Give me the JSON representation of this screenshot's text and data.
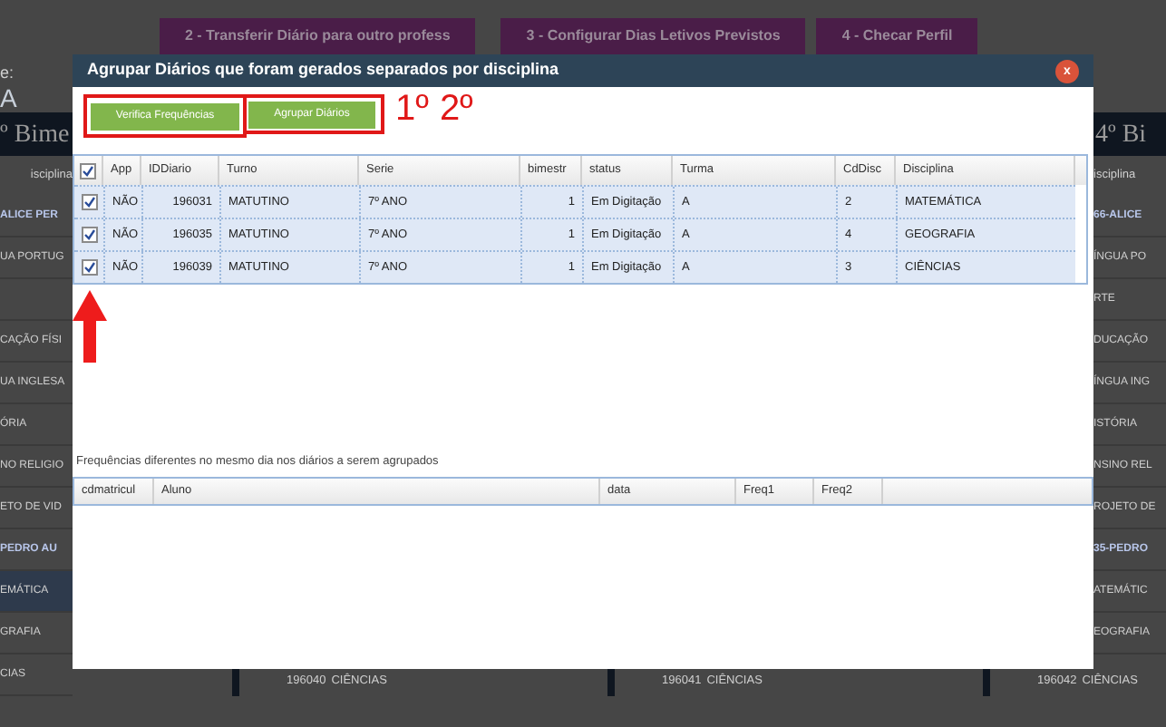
{
  "background": {
    "top_buttons": [
      "2 - Transferir Diário para outro profess",
      "3 - Configurar Dias Letivos Previstos",
      "4 - Checar Perfil"
    ],
    "left_column": {
      "letter": "A",
      "label": "e:",
      "heading": "º Bime",
      "column_header": "isciplina",
      "rows": [
        {
          "text": "ALICE PER",
          "kind": "group",
          "selected": false
        },
        {
          "text": "UA PORTUG",
          "kind": "item",
          "selected": false
        },
        {
          "text": "",
          "kind": "item",
          "selected": false
        },
        {
          "text": "CAÇÃO FÍSI",
          "kind": "item",
          "selected": false
        },
        {
          "text": "UA INGLESA",
          "kind": "item",
          "selected": false
        },
        {
          "text": "ÓRIA",
          "kind": "item",
          "selected": false
        },
        {
          "text": "NO RELIGIO",
          "kind": "item",
          "selected": false
        },
        {
          "text": "ETO DE VID",
          "kind": "item",
          "selected": false
        },
        {
          "text": "PEDRO AU",
          "kind": "group",
          "selected": false
        },
        {
          "text": "EMÁTICA",
          "kind": "item",
          "selected": true
        },
        {
          "text": "GRAFIA",
          "kind": "item",
          "selected": false
        },
        {
          "text": "CIAS",
          "kind": "item",
          "selected": false
        }
      ]
    },
    "right_column": {
      "heading": "4º Bi",
      "column_header": "isciplina",
      "rows": [
        {
          "text": "66-ALICE",
          "kind": "group",
          "selected": false
        },
        {
          "text": "ÍNGUA PO",
          "kind": "item",
          "selected": false
        },
        {
          "text": "RTE",
          "kind": "item",
          "selected": false
        },
        {
          "text": "DUCAÇÃO",
          "kind": "item",
          "selected": false
        },
        {
          "text": "ÍNGUA ING",
          "kind": "item",
          "selected": false
        },
        {
          "text": "ISTÓRIA",
          "kind": "item",
          "selected": false
        },
        {
          "text": "NSINO REL",
          "kind": "item",
          "selected": false
        },
        {
          "text": "ROJETO DE",
          "kind": "item",
          "selected": false
        },
        {
          "text": "35-PEDRO",
          "kind": "group",
          "selected": false
        },
        {
          "text": "ATEMÁTIC",
          "kind": "item",
          "selected": false
        },
        {
          "text": "EOGRAFIA",
          "kind": "item",
          "selected": false
        }
      ]
    },
    "bottom_rows": [
      {
        "id": "196040",
        "name": "CIÊNCIAS"
      },
      {
        "id": "196041",
        "name": "CIÊNCIAS"
      },
      {
        "id": "196042",
        "name": "CIÊNCIAS"
      }
    ]
  },
  "dialog": {
    "title": "Agrupar Diários que foram gerados separados por disciplina",
    "close": "x",
    "buttons": [
      "Verifica Frequências",
      "Agrupar Diários"
    ],
    "annotations": [
      "1º",
      "2º"
    ],
    "diarios_table": {
      "columns": [
        "App",
        "IDDiario",
        "Turno",
        "Serie",
        "bimestr",
        "status",
        "Turma",
        "CdDisc",
        "Disciplina"
      ],
      "all_checked": true,
      "rows": [
        {
          "checked": true,
          "cells": [
            "NÃO",
            "196031",
            "MATUTINO",
            "7º ANO",
            "1",
            "Em Digitação",
            "A",
            "2",
            "MATEMÁTICA"
          ]
        },
        {
          "checked": true,
          "cells": [
            "NÃO",
            "196035",
            "MATUTINO",
            "7º ANO",
            "1",
            "Em Digitação",
            "A",
            "4",
            "GEOGRAFIA"
          ]
        },
        {
          "checked": true,
          "cells": [
            "NÃO",
            "196039",
            "MATUTINO",
            "7º ANO",
            "1",
            "Em Digitação",
            "A",
            "3",
            "CIÊNCIAS"
          ]
        }
      ]
    },
    "caption": "Frequências diferentes no mesmo dia nos diários a serem agrupados",
    "frequencias_table": {
      "columns": [
        "cdmatricul",
        "Aluno",
        "data",
        "Freq1",
        "Freq2"
      ]
    }
  }
}
